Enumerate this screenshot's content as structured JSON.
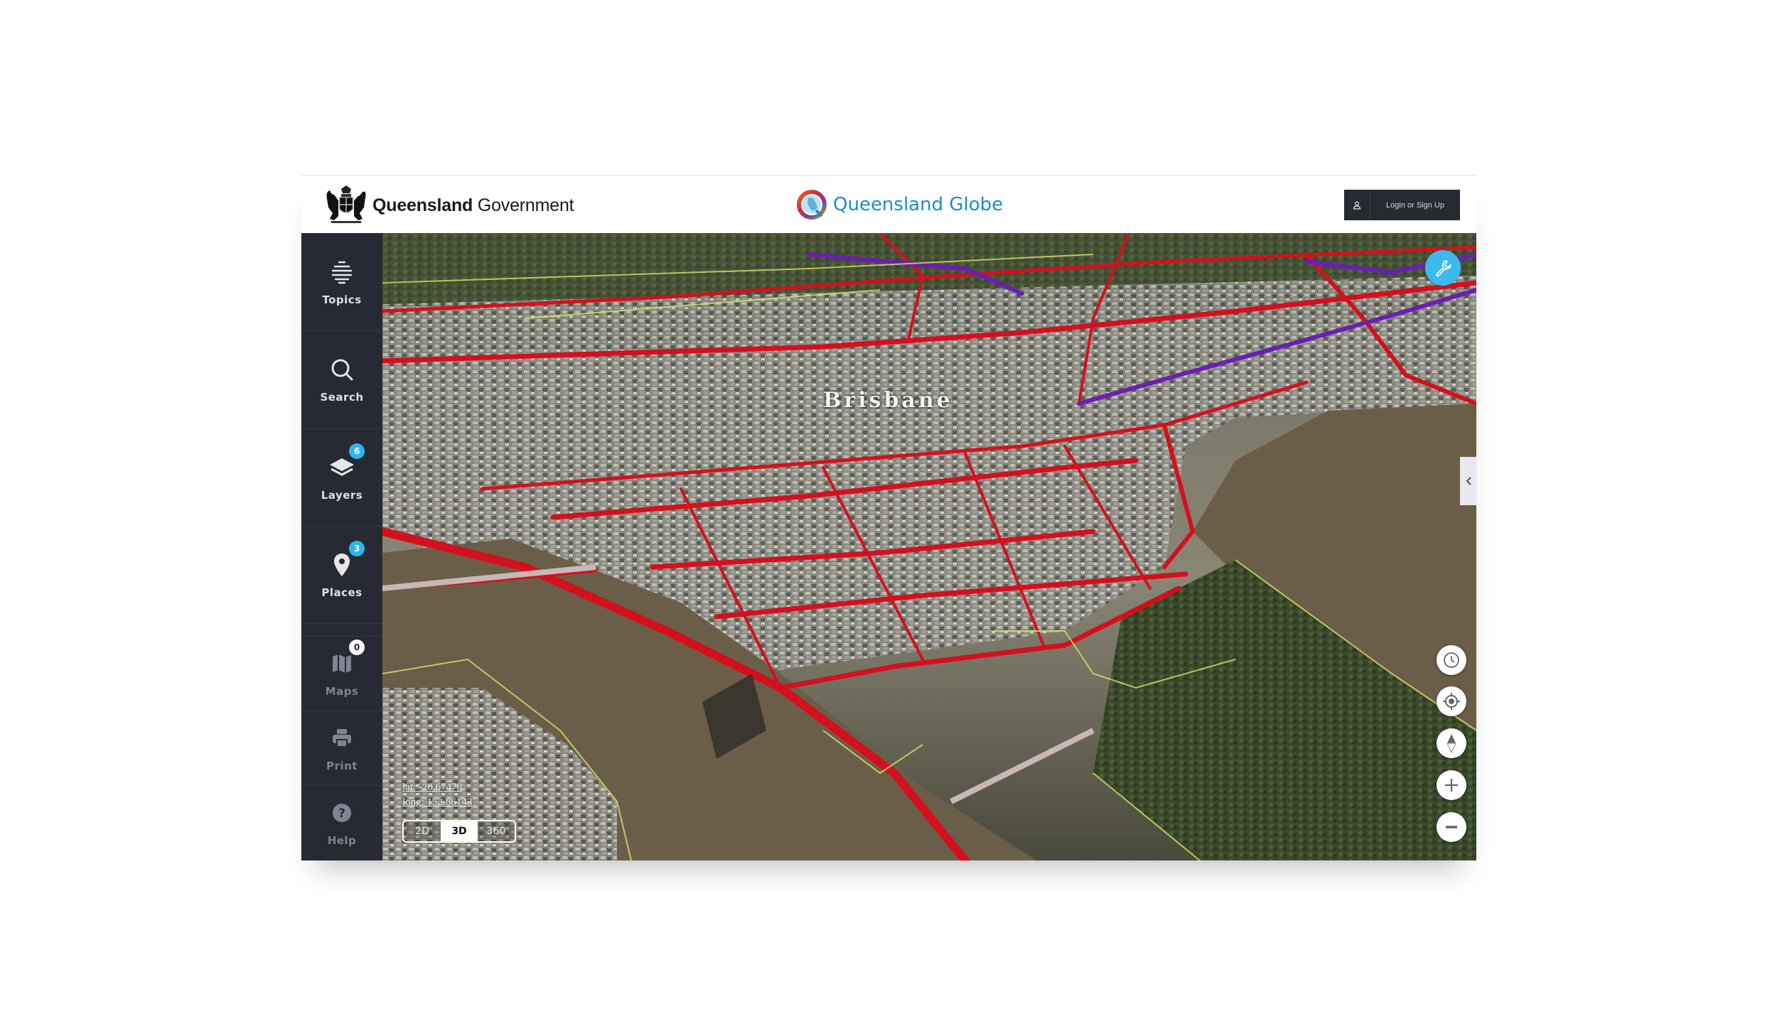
{
  "header": {
    "gov_brand_bold": "Queensland",
    "gov_brand_regular": "Government",
    "app_title": "Queensland Globe",
    "login_label": "Login or Sign Up",
    "login_icon": "user-icon"
  },
  "sidebar": {
    "items": [
      {
        "label": "Topics",
        "icon": "topics-icon",
        "badge": null,
        "enabled": true
      },
      {
        "label": "Search",
        "icon": "search-icon",
        "badge": null,
        "enabled": true
      },
      {
        "label": "Layers",
        "icon": "layers-icon",
        "badge": "6",
        "enabled": true
      },
      {
        "label": "Places",
        "icon": "map-pin-icon",
        "badge": "3",
        "enabled": true
      },
      {
        "label": "Maps",
        "icon": "map-icon",
        "badge": "0",
        "enabled": false
      },
      {
        "label": "Print",
        "icon": "printer-icon",
        "badge": null,
        "enabled": false
      },
      {
        "label": "Help",
        "icon": "help-icon",
        "badge": null,
        "enabled": false
      }
    ]
  },
  "map": {
    "place_label": "Brisbane",
    "coordinates": {
      "lat_label": "lat: -26.67478",
      "long_label": "long: 152.86143"
    },
    "view_modes": [
      {
        "label": "2D",
        "active": false
      },
      {
        "label": "3D",
        "active": true
      },
      {
        "label": "360",
        "active": false
      }
    ],
    "tools_button_icon": "wrench-icon",
    "controls": [
      {
        "name": "time-button",
        "icon": "clock-icon"
      },
      {
        "name": "locate-button",
        "icon": "crosshair-icon"
      },
      {
        "name": "compass-button",
        "icon": "compass-icon"
      },
      {
        "name": "zoom-in-button",
        "icon": "plus-icon"
      },
      {
        "name": "zoom-out-button",
        "icon": "minus-icon"
      }
    ],
    "panel_toggle_icon": "chevron-left-icon"
  },
  "colors": {
    "brand_blue": "#1e8bc6",
    "sidebar_bg": "#272a33",
    "badge_blue": "#2db7ec",
    "tool_button_blue": "#3cb9ee",
    "road_red": "#d4101e",
    "river_brown": "#6b5e49"
  }
}
